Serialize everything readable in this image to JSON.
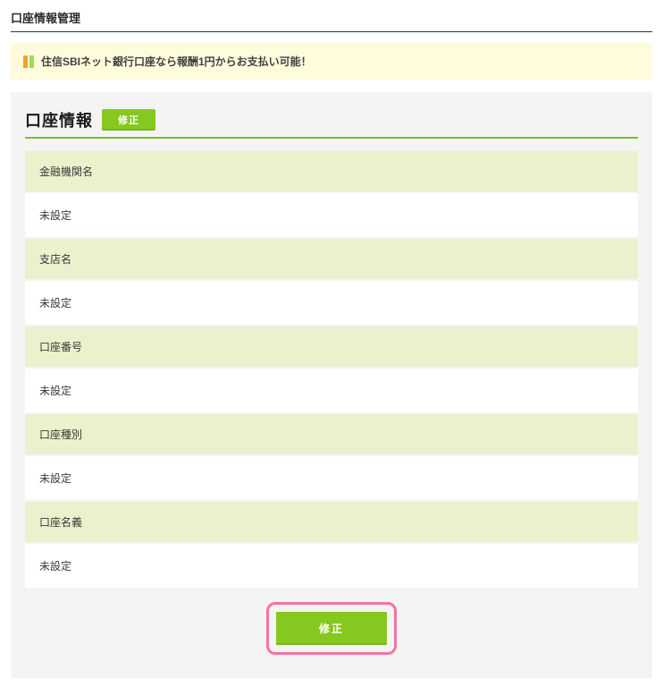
{
  "page_title": "口座情報管理",
  "notice": {
    "text": "住信SBIネット銀行口座なら報酬1円からお支払い可能！"
  },
  "section": {
    "title": "口座情報",
    "edit_small_label": "修正",
    "edit_large_label": "修正",
    "fields": [
      {
        "label": "金融機関名",
        "value": "未設定"
      },
      {
        "label": "支店名",
        "value": "未設定"
      },
      {
        "label": "口座番号",
        "value": "未設定"
      },
      {
        "label": "口座種別",
        "value": "未設定"
      },
      {
        "label": "口座名義",
        "value": "未設定"
      }
    ]
  }
}
